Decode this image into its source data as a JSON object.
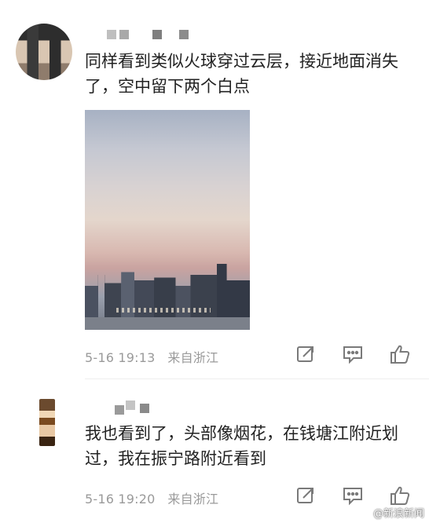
{
  "comments": [
    {
      "text": "同样看到类似火球穿过云层，接近地面消失了，空中留下两个白点",
      "timestamp": "5-16 19:13",
      "source": "来自浙江",
      "photo_alt": "sunset sky over city skyline"
    },
    {
      "text": "我也看到了，头部像烟花，在钱塘江附近划过，我在振宁路附近看到",
      "timestamp": "5-16 19:20",
      "source": "来自浙江"
    }
  ],
  "icons": {
    "share": "share-icon",
    "comment": "comment-icon",
    "like": "like-icon"
  },
  "watermark": "@新浪新闻"
}
